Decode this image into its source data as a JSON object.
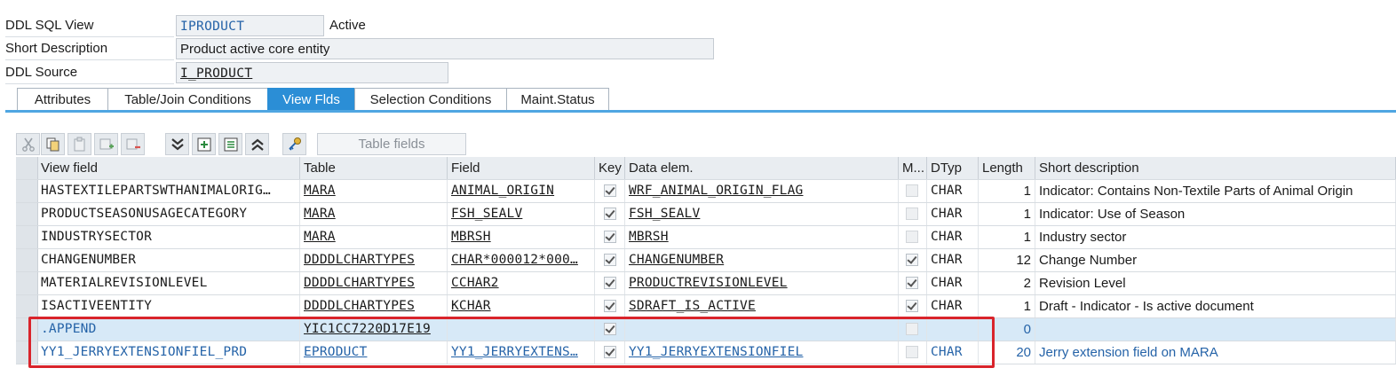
{
  "header": {
    "sql_view_label": "DDL SQL View",
    "sql_view_value": "IPRODUCT",
    "status_label": "Active",
    "short_desc_label": "Short Description",
    "short_desc_value": "Product active core entity",
    "ddl_source_label": "DDL Source",
    "ddl_source_value": "I_PRODUCT"
  },
  "tabs": [
    {
      "label": "Attributes"
    },
    {
      "label": "Table/Join Conditions"
    },
    {
      "label": "View Flds",
      "active": true
    },
    {
      "label": "Selection Conditions"
    },
    {
      "label": "Maint.Status"
    }
  ],
  "toolbar": {
    "table_fields_label": "Table fields",
    "icons": [
      "cut-icon",
      "copy-icon",
      "paste-icon",
      "insert-row-icon",
      "delete-row-icon",
      "collapse-all-icon",
      "expand-icon",
      "select-block-icon",
      "expand-all-icon",
      "key-icon"
    ]
  },
  "grid": {
    "columns": [
      "View field",
      "Table",
      "Field",
      "Key",
      "Data elem.",
      "M...",
      "DTyp",
      "Length",
      "Short description"
    ],
    "rows": [
      {
        "view_field": "HASTEXTILEPARTSWTHANIMALORIG…",
        "table": "MARA",
        "field": "ANIMAL_ORIGIN",
        "key": true,
        "data_elem": "WRF_ANIMAL_ORIGIN_FLAG",
        "m": false,
        "dtyp": "CHAR",
        "length": "1",
        "short_desc": "Indicator: Contains Non-Textile Parts of Animal Origin"
      },
      {
        "view_field": "PRODUCTSEASONUSAGECATEGORY",
        "table": "MARA",
        "field": "FSH_SEALV",
        "key": true,
        "data_elem": "FSH_SEALV",
        "m": false,
        "dtyp": "CHAR",
        "length": "1",
        "short_desc": "Indicator: Use of Season"
      },
      {
        "view_field": "INDUSTRYSECTOR",
        "table": "MARA",
        "field": "MBRSH",
        "key": true,
        "data_elem": "MBRSH",
        "m": false,
        "dtyp": "CHAR",
        "length": "1",
        "short_desc": "Industry sector"
      },
      {
        "view_field": "CHANGENUMBER",
        "table": "DDDDLCHARTYPES",
        "field": "CHAR*000012*000…",
        "key": true,
        "data_elem": "CHANGENUMBER",
        "m": true,
        "dtyp": "CHAR",
        "length": "12",
        "short_desc": "Change Number"
      },
      {
        "view_field": "MATERIALREVISIONLEVEL",
        "table": "DDDDLCHARTYPES",
        "field": "CCHAR2",
        "key": true,
        "data_elem": "PRODUCTREVISIONLEVEL",
        "m": true,
        "dtyp": "CHAR",
        "length": "2",
        "short_desc": "Revision Level"
      },
      {
        "view_field": "ISACTIVEENTITY",
        "table": "DDDDLCHARTYPES",
        "field": "KCHAR",
        "key": true,
        "data_elem": "SDRAFT_IS_ACTIVE",
        "m": true,
        "dtyp": "CHAR",
        "length": "1",
        "short_desc": "Draft - Indicator - Is active document"
      },
      {
        "view_field": ".APPEND",
        "table": "YIC1CC7220D17E19",
        "field": "",
        "key": true,
        "data_elem": "",
        "m": false,
        "dtyp": "",
        "length": "0",
        "short_desc": ""
      },
      {
        "view_field": "YY1_JERRYEXTENSIONFIEL_PRD",
        "table": "EPRODUCT",
        "field": "YY1_JERRYEXTENS…",
        "key": true,
        "data_elem": "YY1_JERRYEXTENSIONFIEL",
        "m": false,
        "dtyp": "CHAR",
        "length": "20",
        "short_desc": "Jerry extension field on MARA"
      }
    ]
  }
}
